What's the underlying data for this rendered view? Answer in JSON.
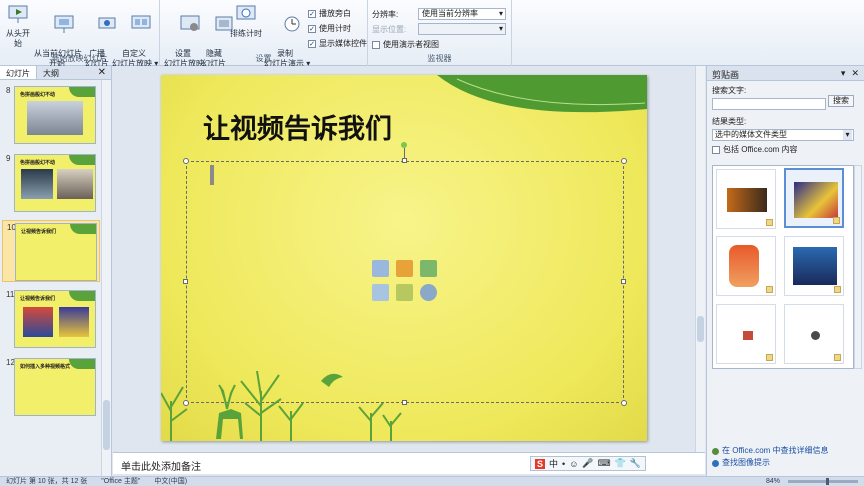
{
  "ribbon": {
    "group1": {
      "label": "开始放映幻灯片",
      "buttons": [
        "从头开始",
        "从当前幻灯片\n开始",
        "广播\n幻灯片",
        "自定义\n幻灯片放映 ▾"
      ]
    },
    "group2": {
      "label": "设置",
      "buttons": [
        "设置\n幻灯片放映",
        "隐藏\n幻灯片",
        "排练计时",
        "录制\n幻灯片演示 ▾"
      ],
      "checks": [
        {
          "label": "播放旁白",
          "checked": true
        },
        {
          "label": "使用计时",
          "checked": true
        },
        {
          "label": "显示媒体控件",
          "checked": true
        }
      ]
    },
    "group3": {
      "label": "监视器",
      "resolution_label": "分辨率:",
      "resolution_value": "使用当前分辨率",
      "show_on_label": "显示位置:",
      "presenter_label": "使用演示者视图"
    }
  },
  "left_panel": {
    "tabs": [
      "幻灯片",
      "大纲"
    ],
    "close": "✕",
    "slides": [
      {
        "num": "8",
        "title": "色拼画般幻不动"
      },
      {
        "num": "9",
        "title": "色拼画般幻不动"
      },
      {
        "num": "10",
        "title": "让视频告诉我们",
        "selected": true
      },
      {
        "num": "11",
        "title": "让视频告诉我们"
      },
      {
        "num": "12",
        "title": "如何插入多种视频格式"
      }
    ]
  },
  "slide": {
    "title": "让视频告诉我们"
  },
  "notes_placeholder": "单击此处添加备注",
  "ime": {
    "logo": "S",
    "items": [
      "中",
      "•",
      "☺",
      "🎤",
      "⌨",
      "👕",
      "🔧"
    ]
  },
  "clipart_pane": {
    "title": "剪贴画",
    "search_label": "搜索文字:",
    "search_button": "搜索",
    "result_type_label": "结果类型:",
    "result_type_value": "选中的媒体文件类型",
    "include_office": "包括 Office.com 内容",
    "link1": "在 Office.com 中查找详细信息",
    "link2": "查找图像提示"
  },
  "statusbar": {
    "slide_info": "幻灯片 第 10 张，共 12 张",
    "theme": "\"Office 主题\"",
    "lang": "中文(中国)",
    "zoom": "84%"
  },
  "colors": {
    "slide_bg": "#f2ec6a",
    "leaf_green": "#5aa33a",
    "accent_blue": "#5a8fd6"
  }
}
